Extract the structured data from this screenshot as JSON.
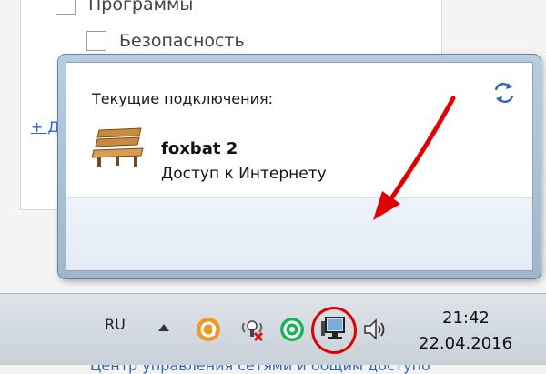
{
  "background": {
    "checkbox_1_label": "Программы",
    "checkbox_2_label": "Безопасность",
    "link_fragment": "+ Д"
  },
  "popup": {
    "title": "Текущие подключения:",
    "connection": {
      "name": "foxbat  2",
      "status": "Доступ к Интернету",
      "icon": "bench-network-icon"
    },
    "network_center_link": "Центр управления сетями и общим доступо",
    "refresh_icon": "refresh-icon",
    "annotation_color": "#e00000"
  },
  "taskbar": {
    "language": "RU",
    "tray_icons": [
      "chevron-up-icon",
      "orange-app-icon",
      "bulb-muted-icon",
      "green-app-icon",
      "network-icon",
      "speaker-icon"
    ],
    "time": "21:42",
    "date": "22.04.2016"
  }
}
